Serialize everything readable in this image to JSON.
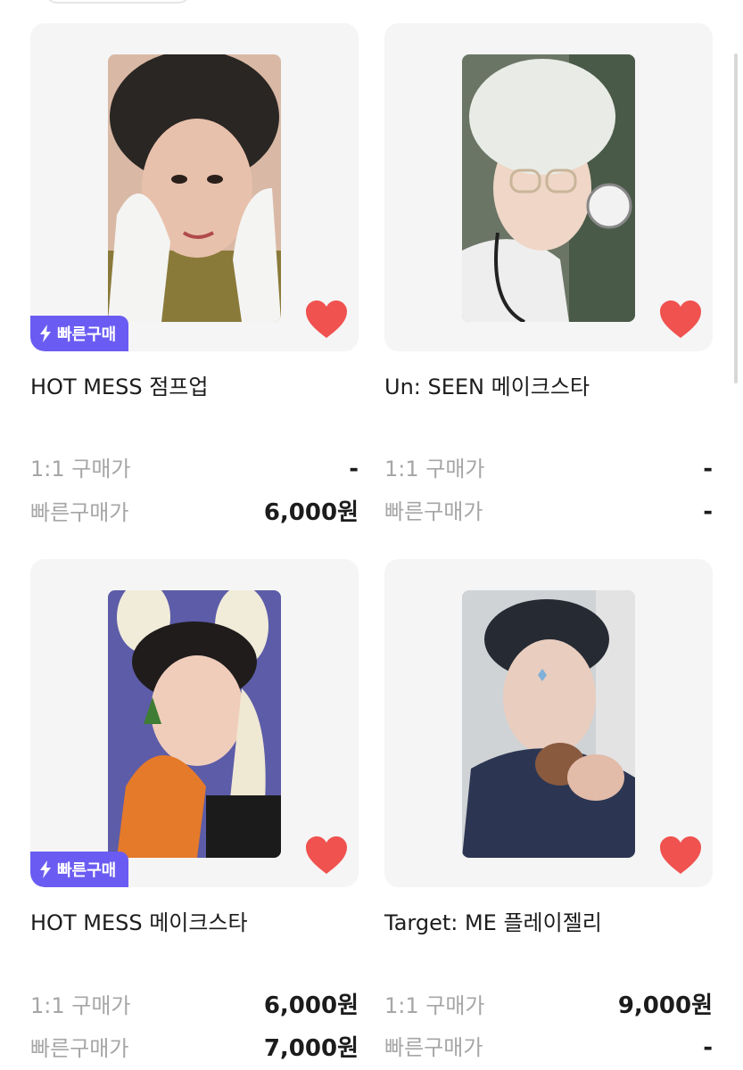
{
  "badge_label": "빠른구매",
  "products": [
    {
      "title": "HOT MESS 점프업",
      "has_badge": true,
      "favorited": true,
      "price_one_to_one_label": "1:1 구매가",
      "price_one_to_one": "-",
      "price_quick_label": "빠른구매가",
      "price_quick": "6,000원",
      "image": "photocard-bunny-hood-white"
    },
    {
      "title": "Un: SEEN 메이크스타",
      "has_badge": false,
      "favorited": true,
      "price_one_to_one_label": "1:1 구매가",
      "price_one_to_one": "-",
      "price_quick_label": "빠른구매가",
      "price_quick": "-",
      "image": "photocard-doctor-stethoscope"
    },
    {
      "title": "HOT MESS 메이크스타",
      "has_badge": true,
      "favorited": true,
      "price_one_to_one_label": "1:1 구매가",
      "price_one_to_one": "6,000원",
      "price_quick_label": "빠른구매가",
      "price_quick": "7,000원",
      "image": "photocard-bunny-carrot"
    },
    {
      "title": "Target: ME 플레이젤리",
      "has_badge": false,
      "favorited": true,
      "price_one_to_one_label": "1:1 구매가",
      "price_one_to_one": "9,000원",
      "price_quick_label": "빠른구매가",
      "price_quick": "-",
      "image": "photocard-cookie-wink"
    }
  ],
  "colors": {
    "badge": "#6a5cf2",
    "heart": "#f0524f",
    "label_gray": "#a6a6a6",
    "card_bg": "#f5f5f5"
  }
}
